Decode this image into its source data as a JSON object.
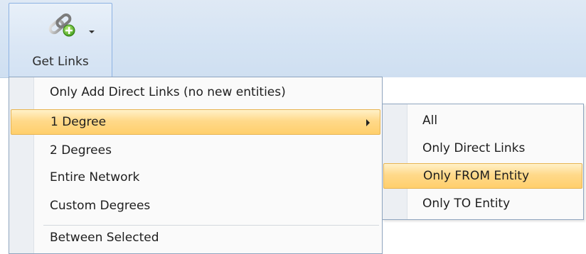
{
  "ribbon": {
    "button": {
      "label": "Get Links",
      "icon": "chain-link-add-icon",
      "dropdown_icon": "dropdown-arrow-icon"
    }
  },
  "menu": {
    "items": [
      {
        "label": "Only Add Direct Links (no new entities)"
      },
      {
        "label": "1 Degree",
        "has_submenu": true,
        "highlighted": true
      },
      {
        "label": "2 Degrees"
      },
      {
        "label": "Entire Network"
      },
      {
        "label": "Custom Degrees"
      },
      {
        "label": "Between Selected"
      }
    ]
  },
  "submenu": {
    "items": [
      {
        "label": "All"
      },
      {
        "label": "Only Direct Links"
      },
      {
        "label": "Only FROM Entity",
        "highlighted": true
      },
      {
        "label": "Only TO Entity"
      }
    ]
  },
  "colors": {
    "highlight": "#ffd98a",
    "ribbon_bg": "#d4e3f3",
    "menu_border": "#8fa5bf"
  }
}
